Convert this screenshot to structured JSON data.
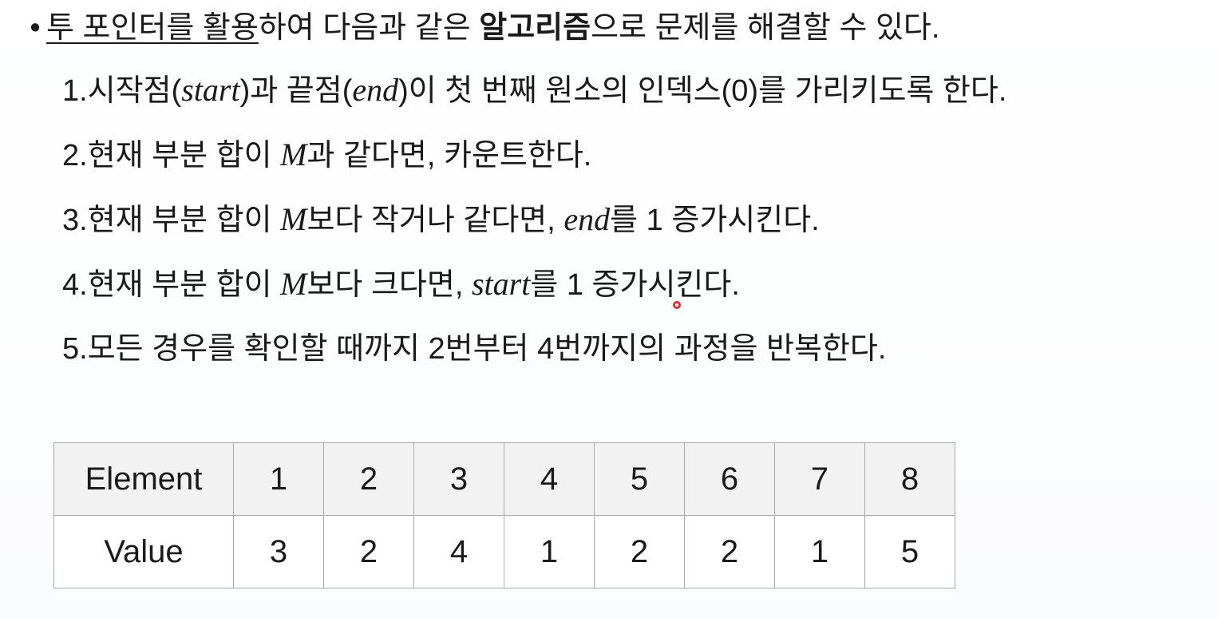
{
  "bullet": {
    "dot": "•",
    "underlined": "투 포인터를 활용",
    "middle": "하여 다음과 같은 ",
    "bold": "알고리즘",
    "end": "으로 문제를 해결할 수 있다."
  },
  "steps": [
    {
      "num": "1.",
      "parts": [
        {
          "t": "시작점("
        },
        {
          "m": "start"
        },
        {
          "t": ")과 끝점("
        },
        {
          "m": "end"
        },
        {
          "t": ")이 첫 번째 원소의 인덱스(0)를 가리키도록 한다."
        }
      ]
    },
    {
      "num": "2.",
      "parts": [
        {
          "t": "현재 부분 합이 "
        },
        {
          "m": "M"
        },
        {
          "t": "과 같다면, 카운트한다."
        }
      ]
    },
    {
      "num": "3.",
      "parts": [
        {
          "t": "현재 부분 합이 "
        },
        {
          "m": "M"
        },
        {
          "t": "보다 작거나 같다면, "
        },
        {
          "m": "end"
        },
        {
          "t": "를 1 증가시킨다."
        }
      ]
    },
    {
      "num": "4.",
      "parts": [
        {
          "t": "현재 부분 합이 "
        },
        {
          "m": "M"
        },
        {
          "t": "보다 크다면, "
        },
        {
          "m": "start"
        },
        {
          "t": "를 1 증가시킨다."
        }
      ]
    },
    {
      "num": "5.",
      "parts": [
        {
          "t": "모든 경우를 확인할 때까지 2번부터 4번까지의 과정을 반복한다."
        }
      ]
    }
  ],
  "table": {
    "element_label": "Element",
    "value_label": "Value",
    "elements": [
      "1",
      "2",
      "3",
      "4",
      "5",
      "6",
      "7",
      "8"
    ],
    "values": [
      "3",
      "2",
      "4",
      "1",
      "2",
      "2",
      "1",
      "5"
    ]
  },
  "colors": {
    "pointer": "#e0303a",
    "table_border": "#a9a9a9",
    "header_row_bg": "#f2f2f2"
  }
}
